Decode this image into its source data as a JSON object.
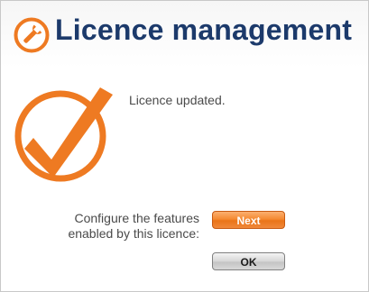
{
  "header": {
    "title": "Licence management",
    "icon": "wrench-icon"
  },
  "status": {
    "icon": "checkmark-icon",
    "message": "Licence updated."
  },
  "configure": {
    "label_line1": "Configure the features",
    "label_line2": "enabled by this licence:",
    "next_label": "Next"
  },
  "footer": {
    "ok_label": "OK"
  },
  "colors": {
    "accent": "#ee7a22",
    "title": "#1c3a6b",
    "text": "#4a4a4a"
  }
}
